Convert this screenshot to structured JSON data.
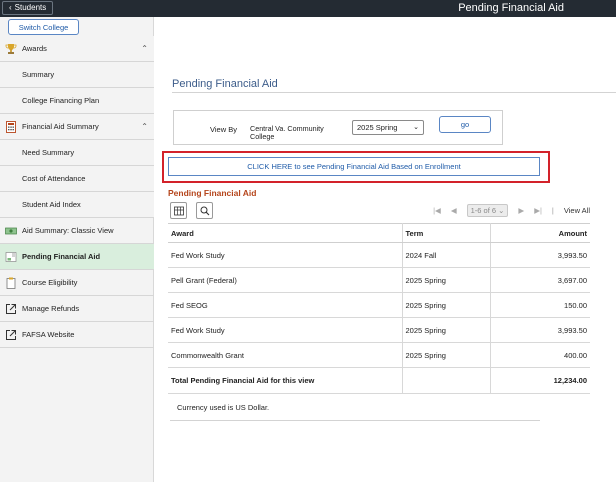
{
  "topbar": {
    "back_label": "Students",
    "title": "Pending Financial Aid"
  },
  "sidebar": {
    "switch_college": "Switch College",
    "items": [
      {
        "label": "Awards",
        "kind": "group",
        "icon": "trophy-icon"
      },
      {
        "label": "Summary",
        "kind": "sub"
      },
      {
        "label": "College Financing Plan",
        "kind": "sub"
      },
      {
        "label": "Financial Aid Summary",
        "kind": "group",
        "icon": "calculator-icon"
      },
      {
        "label": "Need Summary",
        "kind": "sub"
      },
      {
        "label": "Cost of Attendance",
        "kind": "sub"
      },
      {
        "label": "Student Aid Index",
        "kind": "sub"
      },
      {
        "label": "Aid Summary: Classic View",
        "kind": "top",
        "icon": "money-icon"
      },
      {
        "label": "Pending Financial Aid",
        "kind": "top",
        "icon": "pending-aid-icon",
        "active": true
      },
      {
        "label": "Course Eligibility",
        "kind": "top",
        "icon": "clipboard-icon"
      },
      {
        "label": "Manage Refunds",
        "kind": "top",
        "icon": "external-link-icon"
      },
      {
        "label": "FAFSA Website",
        "kind": "top",
        "icon": "external-link-icon"
      }
    ]
  },
  "main": {
    "heading": "Pending Financial Aid",
    "view_by_label": "View By",
    "college": "Central Va. Community College",
    "term_selected": "2025 Spring",
    "go_label": "go",
    "enrollment_button": "CLICK HERE to see Pending Financial Aid Based on Enrollment",
    "grid_title": "Pending Financial Aid",
    "pager_count": "1-6 of 6",
    "view_all": "View All",
    "columns": [
      "Award",
      "Term",
      "Amount"
    ],
    "rows": [
      {
        "award": "Fed Work Study",
        "term": "2024 Fall",
        "amount": "3,993.50"
      },
      {
        "award": "Pell Grant (Federal)",
        "term": "2025 Spring",
        "amount": "3,697.00"
      },
      {
        "award": "Fed SEOG",
        "term": "2025 Spring",
        "amount": "150.00"
      },
      {
        "award": "Fed Work Study",
        "term": "2025 Spring",
        "amount": "3,993.50"
      },
      {
        "award": "Commonwealth Grant",
        "term": "2025 Spring",
        "amount": "400.00"
      }
    ],
    "total_label": "Total Pending Financial Aid for this view",
    "total_amount": "12,234.00",
    "currency_note": "Currency used is US Dollar."
  },
  "colors": {
    "topbar": "#242b33",
    "link_blue": "#1f5ba8",
    "highlight_red": "#d3222a",
    "grid_title": "#b5451b",
    "active_nav": "#d9eedd"
  }
}
